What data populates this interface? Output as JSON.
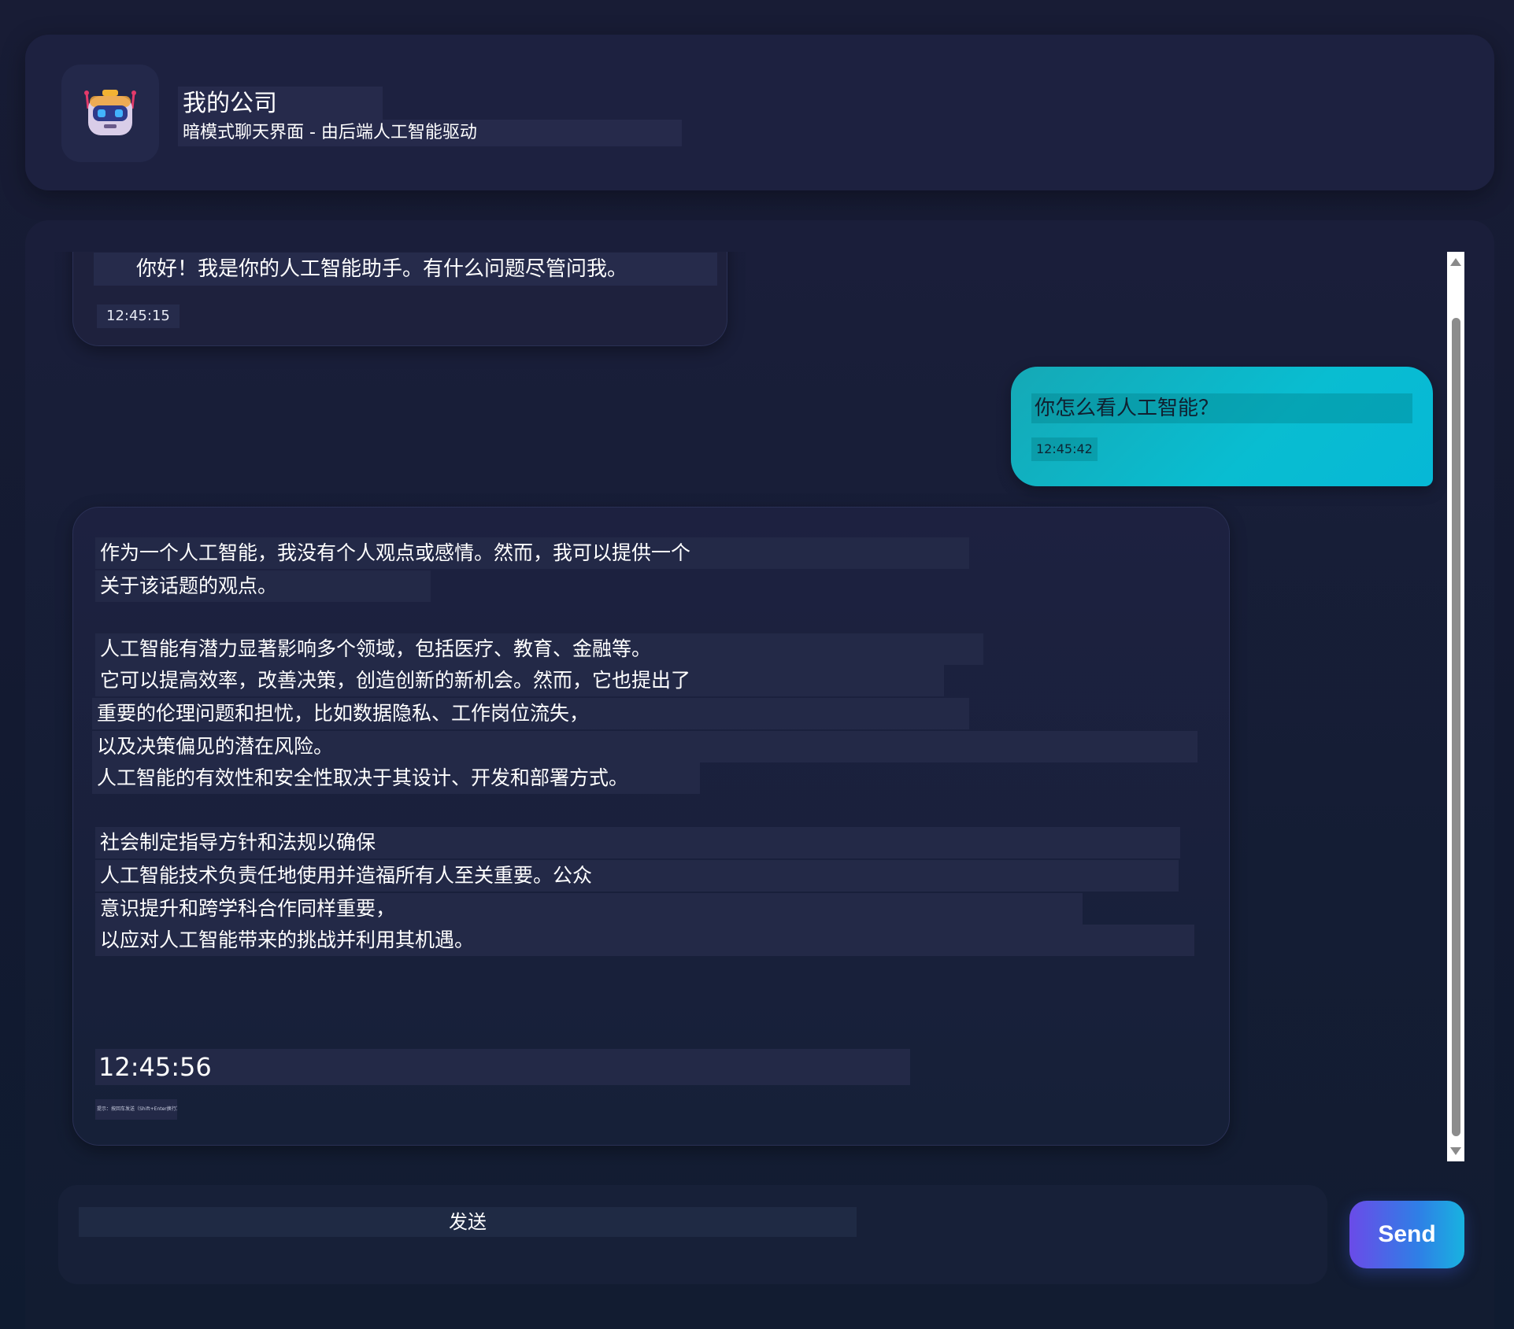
{
  "header": {
    "title": "我的公司",
    "subtitle": "暗模式聊天界面 - 由后端人工智能驱动",
    "avatar_icon": "robot-icon"
  },
  "messages": [
    {
      "role": "bot",
      "text": "你好！我是你的人工智能助手。有什么问题尽管问我。",
      "time": "12:45:15"
    },
    {
      "role": "user",
      "text": "你怎么看人工智能？",
      "time": "12:45:42"
    },
    {
      "role": "bot",
      "lines": [
        "作为一个人工智能，我没有个人观点或感情。然而，我可以提供一个",
        "关于该话题的观点。",
        "人工智能有潜力显著影响多个领域，包括医疗、教育、金融等。",
        "它可以提高效率，改善决策，创造创新的新机会。然而，它也提出了",
        "重要的伦理问题和担忧，比如数据隐私、工作岗位流失，",
        "以及决策偏见的潜在风险。",
        "人工智能的有效性和安全性取决于其设计、开发和部署方式。",
        "社会制定指导方针和法规以确保",
        "人工智能技术负责任地使用并造福所有人至关重要。公众",
        "意识提升和跨学科合作同样重要，",
        "以应对人工智能带来的挑战并利用其机遇。"
      ],
      "time": "12:45:56",
      "note": "提示：按回车发送（Shift+Enter换行）"
    }
  ],
  "composer": {
    "placeholder": "发送",
    "send_label": "Send"
  },
  "colors": {
    "background": "#151a30",
    "user_bubble": "#09bdd1",
    "send_gradient_start": "#6a4be8",
    "send_gradient_end": "#18b3e0"
  }
}
